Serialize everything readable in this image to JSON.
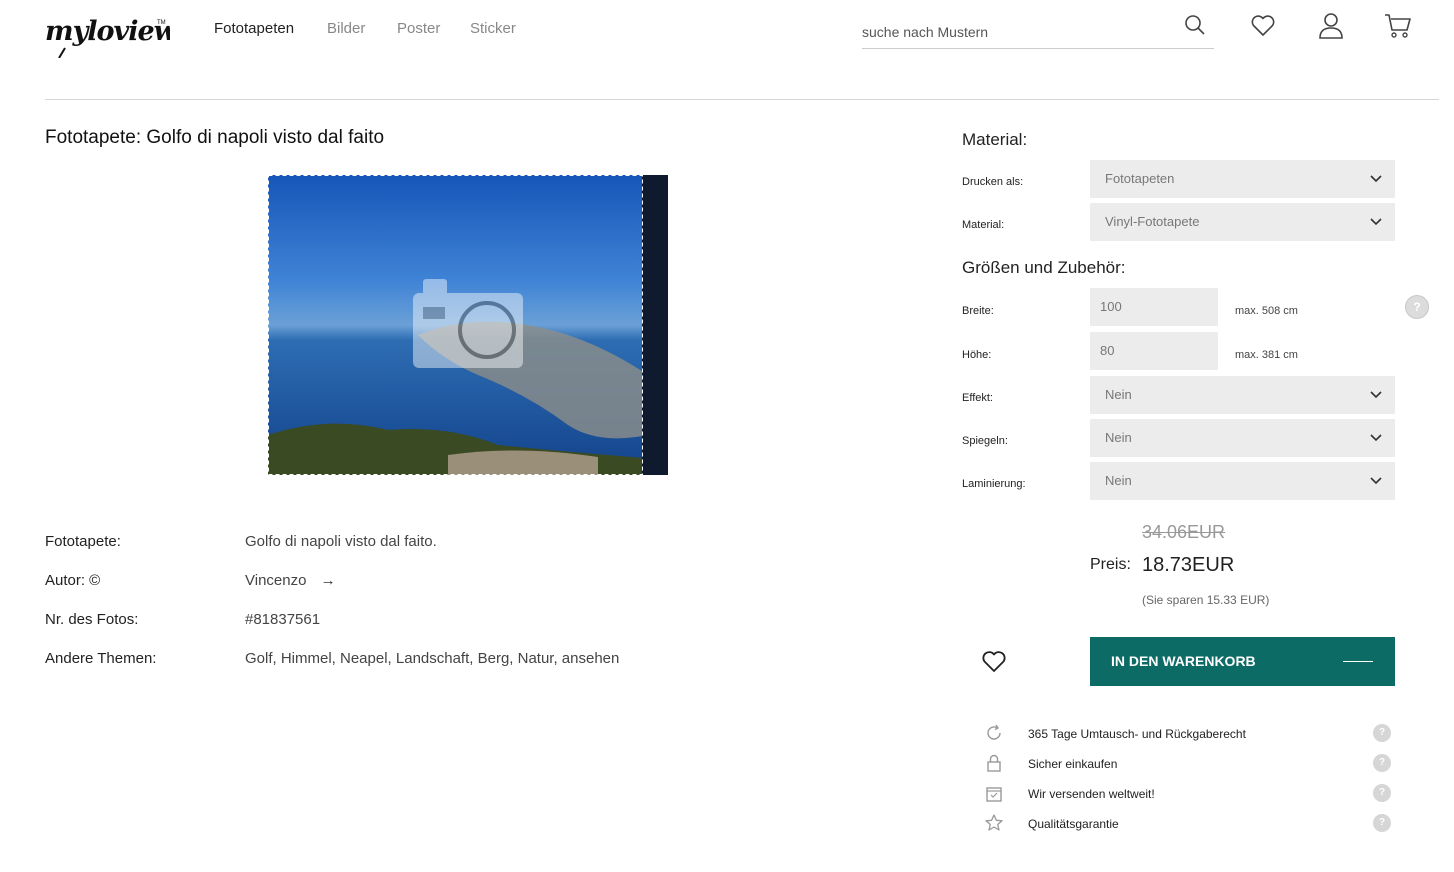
{
  "header": {
    "logo_text": "myloview",
    "nav": [
      "Fototapeten",
      "Bilder",
      "Poster",
      "Sticker"
    ],
    "search_placeholder": "suche nach Mustern",
    "icons": [
      "search-icon",
      "heart-icon",
      "user-icon",
      "cart-icon"
    ]
  },
  "product": {
    "title": "Fototapete: Golfo di napoli visto dal faito",
    "info": [
      {
        "label": "Fototapete:",
        "value": "Golfo di napoli visto dal faito."
      },
      {
        "label": "Autor: ©",
        "value": "Vincenzo"
      },
      {
        "label": "Nr. des Fotos:",
        "value": "#81837561"
      },
      {
        "label": "Andere Themen:",
        "value": "Golf, Himmel, Neapel, Landschaft, Berg, Natur, ansehen"
      }
    ]
  },
  "config": {
    "material_heading": "Material:",
    "print_as_label": "Drucken als:",
    "print_as_value": "Fototapeten",
    "material_label": "Material:",
    "material_value": "Vinyl-Fototapete",
    "sizes_heading": "Größen und Zubehör:",
    "width_label": "Breite:",
    "width_value": "100",
    "width_max": "max. 508 cm",
    "height_label": "Höhe:",
    "height_value": "80",
    "height_max": "max. 381 cm",
    "effect_label": "Effekt:",
    "effect_value": "Nein",
    "mirror_label": "Spiegeln:",
    "mirror_value": "Nein",
    "lamination_label": "Laminierung:",
    "lamination_value": "Nein",
    "help_glyph": "?"
  },
  "price": {
    "old": "34.06EUR",
    "label": "Preis:",
    "current": "18.73EUR",
    "savings": "(Sie sparen 15.33 EUR)"
  },
  "cart_button": "IN DEN WARENKORB",
  "features": [
    {
      "icon": "refresh-icon",
      "text": "365 Tage Umtausch- und Rückgaberecht"
    },
    {
      "icon": "lock-icon",
      "text": "Sicher einkaufen"
    },
    {
      "icon": "shipping-box-icon",
      "text": "Wir versenden weltweit!"
    },
    {
      "icon": "star-icon",
      "text": "Qualitätsgarantie"
    }
  ],
  "colors": {
    "accent": "#0d6b65",
    "field_bg": "#ececec"
  }
}
